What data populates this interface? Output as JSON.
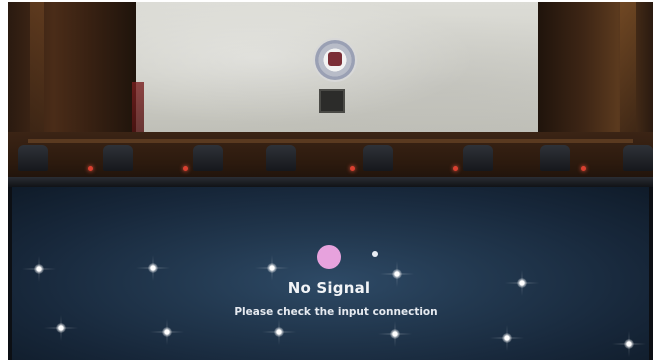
{
  "screen": {
    "title": "No Signal",
    "message": "Please check the input connection"
  },
  "icons": {
    "status_icon": "pink-circle-icon",
    "indicator": "white-dot-icon"
  },
  "colors": {
    "screen_background": "#22384f",
    "status_icon": "#e7a2dd",
    "text": "#f2f4f7",
    "marble_wall": "#cfcfc8",
    "wood_paneling": "#3b2415"
  }
}
